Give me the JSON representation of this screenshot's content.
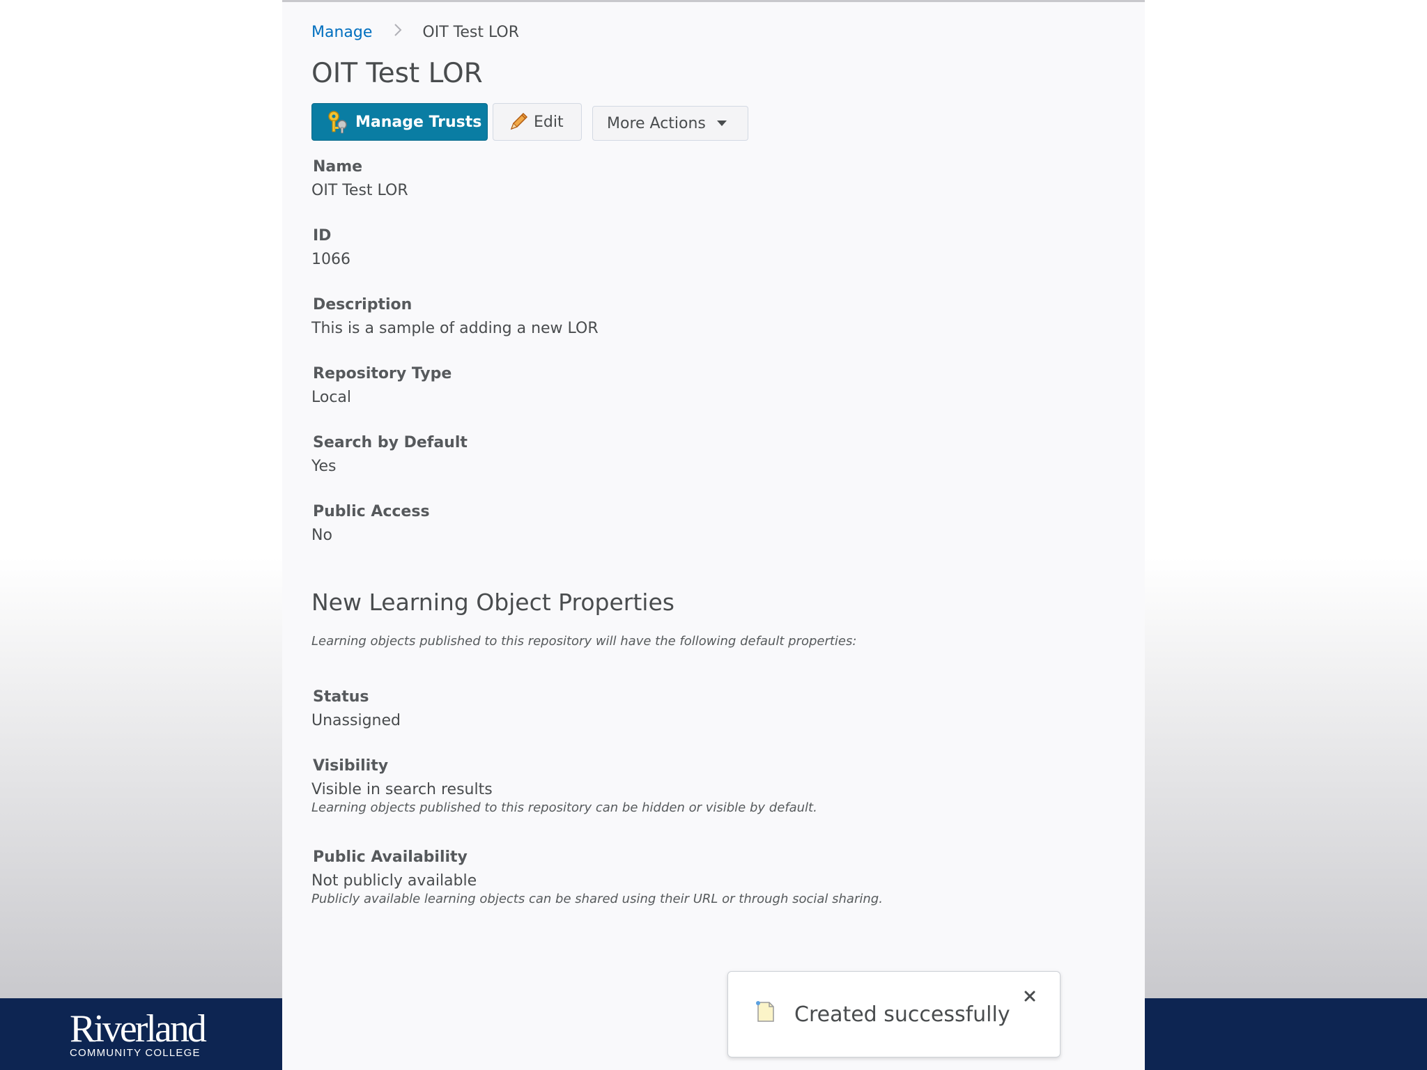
{
  "breadcrumb": {
    "parent": "Manage",
    "current": "OIT Test LOR"
  },
  "page": {
    "title": "OIT Test LOR"
  },
  "toolbar": {
    "manage_trusts_label": "Manage Trusts",
    "edit_label": "Edit",
    "more_actions_label": "More Actions"
  },
  "fields": {
    "name": {
      "label": "Name",
      "value": "OIT Test LOR"
    },
    "id": {
      "label": "ID",
      "value": "1066"
    },
    "description": {
      "label": "Description",
      "value": "This is a sample of adding a new LOR"
    },
    "repository_type": {
      "label": "Repository Type",
      "value": "Local"
    },
    "search_by_default": {
      "label": "Search by Default",
      "value": "Yes"
    },
    "public_access": {
      "label": "Public Access",
      "value": "No"
    }
  },
  "properties": {
    "title": "New Learning Object Properties",
    "intro": "Learning objects published to this repository will have the following default properties:",
    "status": {
      "label": "Status",
      "value": "Unassigned"
    },
    "visibility": {
      "label": "Visibility",
      "value": "Visible in search results",
      "help": "Learning objects published to this repository can be hidden or visible by default."
    },
    "public_availability": {
      "label": "Public Availability",
      "value": "Not publicly available",
      "help": "Publicly available learning objects can be shared using their URL or through social sharing."
    }
  },
  "toast": {
    "message": "Created successfully"
  },
  "branding": {
    "name": "Riverland",
    "subtitle": "COMMUNITY COLLEGE"
  },
  "colors": {
    "primary_button": "#0a7da3",
    "link": "#006fbf",
    "brand_bar": "#0d2552"
  },
  "icons": {
    "manage_trusts": "keys-icon",
    "edit": "pencil-icon",
    "more_actions": "caret-down-icon",
    "toast": "document-icon",
    "toast_close": "close-icon"
  }
}
